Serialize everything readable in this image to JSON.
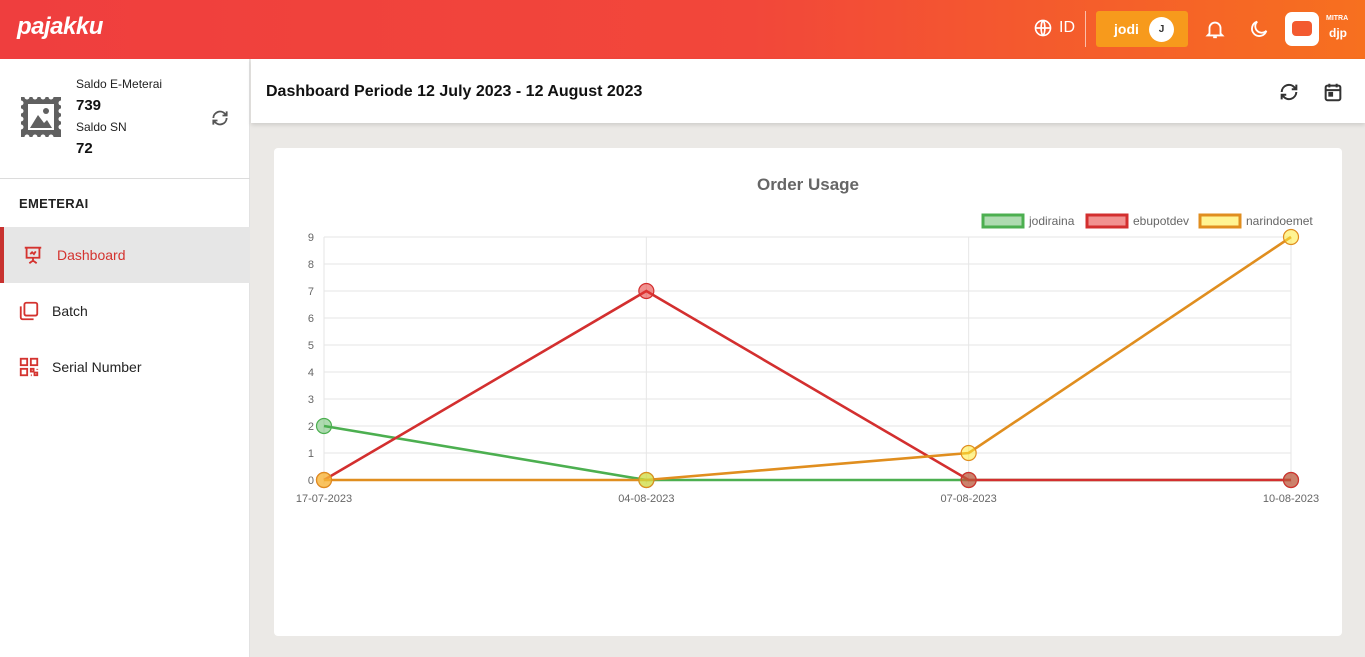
{
  "topbar": {
    "logo": "pajakku",
    "language": "ID",
    "user_name": "jodi",
    "user_initial": "J",
    "mitra_label": "MITRA",
    "mitra_brand": "djp"
  },
  "sidebar": {
    "saldo_emeterai_label": "Saldo E-Meterai",
    "saldo_emeterai_value": "739",
    "saldo_sn_label": "Saldo SN",
    "saldo_sn_value": "72",
    "section_title": "EMETERAI",
    "items": [
      {
        "label": "Dashboard",
        "icon": "presentation-icon",
        "active": true
      },
      {
        "label": "Batch",
        "icon": "copy-icon",
        "active": false
      },
      {
        "label": "Serial Number",
        "icon": "qr-code-icon",
        "active": false
      }
    ]
  },
  "header": {
    "title": "Dashboard Periode 12 July 2023 - 12 August 2023"
  },
  "colors": {
    "accent": "#d4332f",
    "jodiraina": "#4caf50",
    "ebupotdev": "#d32f2f",
    "narindoemet": "#e08e1f"
  },
  "chart_data": {
    "type": "line",
    "title": "Order Usage",
    "x": [
      "17-07-2023",
      "04-08-2023",
      "07-08-2023",
      "10-08-2023"
    ],
    "ylim": [
      0,
      9
    ],
    "yticks": [
      "0",
      "1",
      "2",
      "3",
      "4",
      "5",
      "6",
      "7",
      "8",
      "9"
    ],
    "grid": true,
    "legend": "top-right",
    "series": [
      {
        "name": "jodiraina",
        "values": [
          2,
          0,
          0,
          0
        ]
      },
      {
        "name": "ebupotdev",
        "values": [
          0,
          7,
          0,
          0
        ]
      },
      {
        "name": "narindoemet",
        "values": [
          0,
          0,
          1,
          9
        ]
      }
    ]
  }
}
